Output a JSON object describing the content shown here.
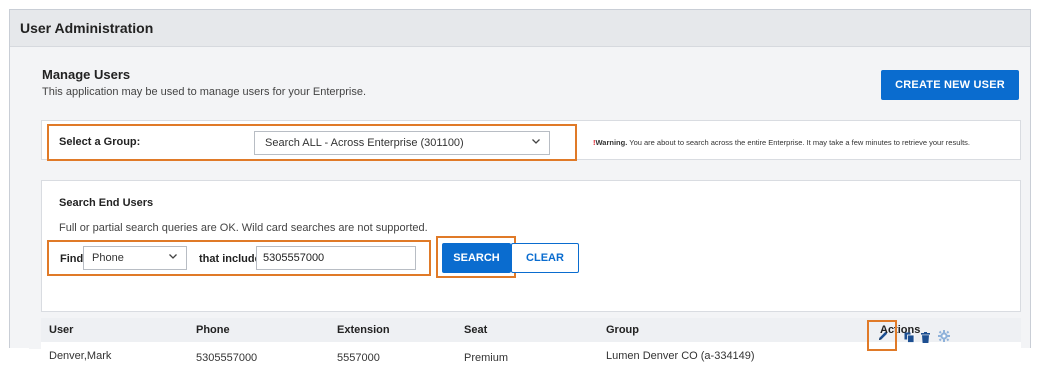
{
  "header": {
    "title": "User Administration"
  },
  "manage": {
    "title": "Manage Users",
    "description": "This application may be used to manage users for your Enterprise.",
    "create_button": "CREATE NEW USER"
  },
  "group": {
    "label": "Select a Group:",
    "selected": "Search ALL - Across Enterprise (301100)",
    "warning_mark": "!",
    "warning_title": "Warning.",
    "warning_text": " You are about to search across the entire Enterprise. It may take a few minutes to retrieve your results."
  },
  "search": {
    "title": "Search End Users",
    "description": "Full or partial search queries are OK. Wild card searches are not supported.",
    "find_label": "Find",
    "field_selected": "Phone",
    "includes_label": "that includes",
    "query_value": "5305557000",
    "search_button": "SEARCH",
    "clear_button": "CLEAR"
  },
  "table": {
    "columns": [
      "User",
      "Phone",
      "Extension",
      "Seat",
      "Group",
      "Actions"
    ],
    "rows": [
      {
        "user": "Denver,Mark",
        "phone": "5305557000",
        "extension": "5557000",
        "seat": "Premium",
        "group": "Lumen Denver CO (a-334149)",
        "actions": [
          "pencil-icon",
          "copy-icon",
          "trash-icon",
          "gear-icon"
        ]
      }
    ]
  },
  "colors": {
    "primary": "#0a6ccf",
    "highlight": "#e07a28",
    "warning": "#e0202a",
    "action_icon": "#1d4f91",
    "action_icon_muted": "#8fb2da"
  }
}
